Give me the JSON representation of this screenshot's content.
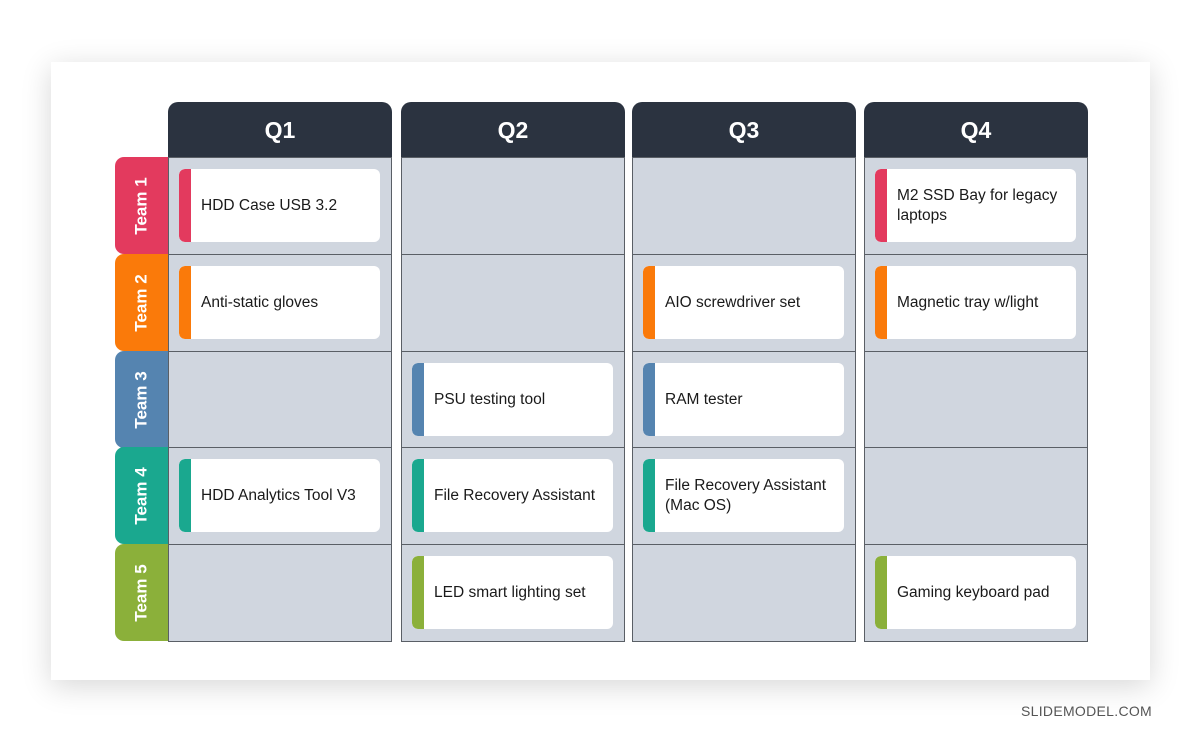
{
  "columns": [
    "Q1",
    "Q2",
    "Q3",
    "Q4"
  ],
  "rows": [
    {
      "label": "Team 1",
      "color": "#e33a5e"
    },
    {
      "label": "Team 2",
      "color": "#fa7a0a"
    },
    {
      "label": "Team 3",
      "color": "#5584b0"
    },
    {
      "label": "Team 4",
      "color": "#1aa88f"
    },
    {
      "label": "Team 5",
      "color": "#8bb03a"
    }
  ],
  "cards": [
    {
      "row": 0,
      "col": 0,
      "text": "HDD Case USB 3.2"
    },
    {
      "row": 0,
      "col": 3,
      "text": "M2 SSD Bay for legacy laptops"
    },
    {
      "row": 1,
      "col": 0,
      "text": "Anti-static gloves"
    },
    {
      "row": 1,
      "col": 2,
      "text": "AIO screwdriver set"
    },
    {
      "row": 1,
      "col": 3,
      "text": "Magnetic tray w/light"
    },
    {
      "row": 2,
      "col": 1,
      "text": "PSU testing tool"
    },
    {
      "row": 2,
      "col": 2,
      "text": "RAM tester"
    },
    {
      "row": 3,
      "col": 0,
      "text": "HDD Analytics Tool V3"
    },
    {
      "row": 3,
      "col": 1,
      "text": "File Recovery Assistant"
    },
    {
      "row": 3,
      "col": 2,
      "text": "File Recovery Assistant (Mac OS)"
    },
    {
      "row": 4,
      "col": 1,
      "text": "LED smart lighting set"
    },
    {
      "row": 4,
      "col": 3,
      "text": "Gaming keyboard pad"
    }
  ],
  "brand": "SLIDEMODEL.COM"
}
